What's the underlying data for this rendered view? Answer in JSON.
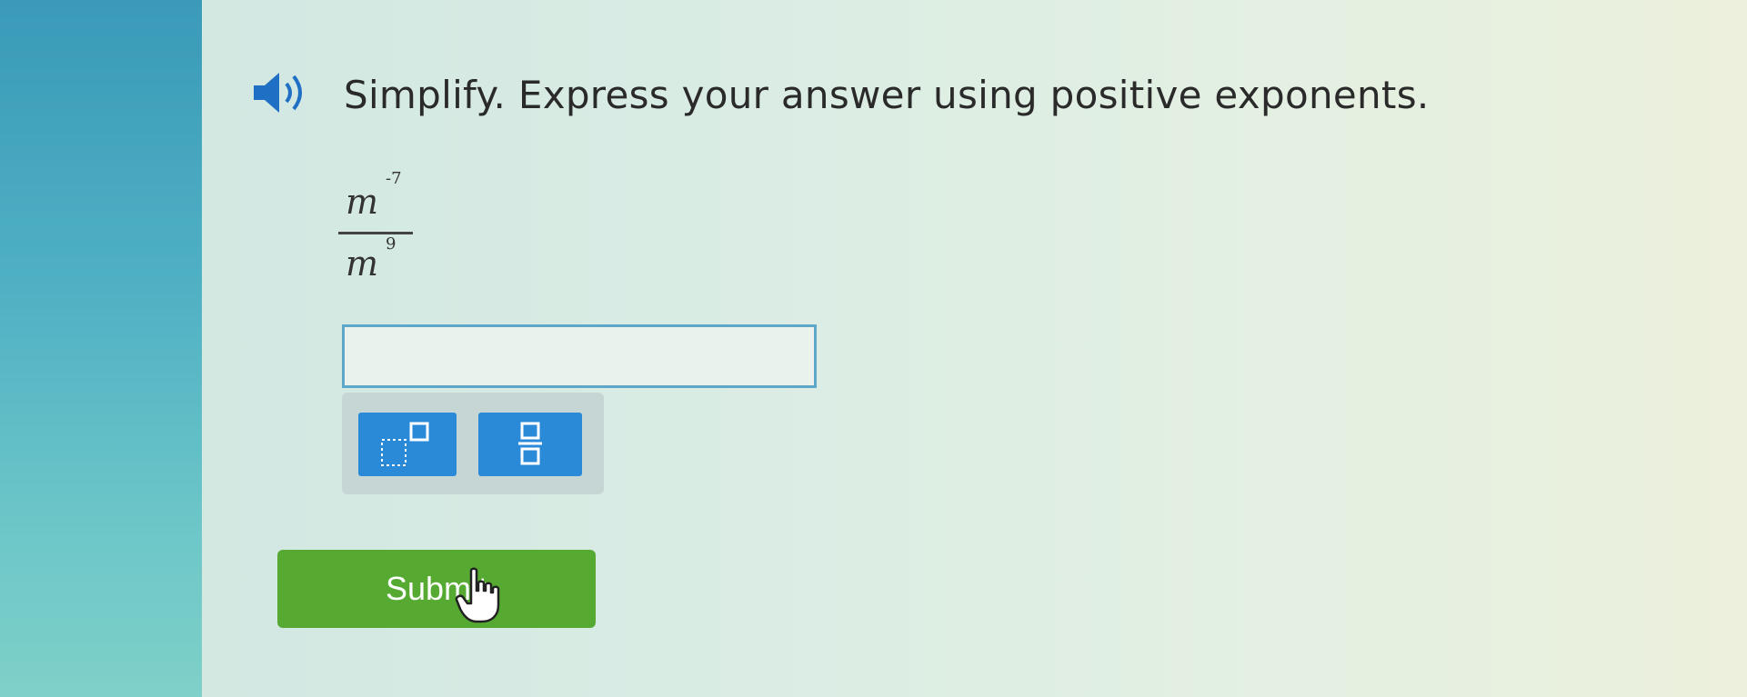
{
  "instruction": "Simplify. Express your answer using positive exponents.",
  "problem": {
    "numerator_base": "m",
    "numerator_exponent": "-7",
    "denominator_base": "m",
    "denominator_exponent": "9"
  },
  "answer_input": {
    "value": "",
    "placeholder": ""
  },
  "toolbar": {
    "buttons": [
      {
        "name": "exponent",
        "icon": "exponent-template-icon"
      },
      {
        "name": "fraction",
        "icon": "fraction-template-icon"
      }
    ]
  },
  "submit": {
    "label": "Submit"
  },
  "colors": {
    "accent_blue": "#2b8ad8",
    "submit_green": "#56aa32",
    "input_border": "#5fa7c9",
    "audio_icon": "#1f6fc4"
  }
}
